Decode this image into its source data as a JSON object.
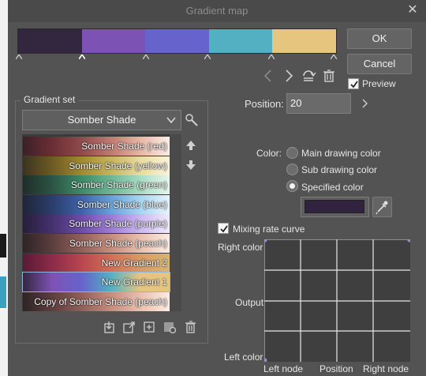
{
  "dialog": {
    "title": "Gradient map",
    "ok_label": "OK",
    "cancel_label": "Cancel",
    "preview_label": "Preview",
    "preview_checked": true
  },
  "gradient_bar": {
    "segments": [
      "#33273f",
      "#7d52b5",
      "#6663cc",
      "#53b0c2",
      "#e6c57f"
    ],
    "node_colors": [
      "#ffffff",
      "#cfcfcf",
      "#cfcfcf",
      "#cfcfcf",
      "#cfcfcf",
      "#cfcfcf"
    ]
  },
  "gradient_set": {
    "group_label": "Gradient set",
    "selected": "Somber Shade",
    "items": [
      {
        "label": "Somber Shade (red)",
        "colors": [
          "#3a2126",
          "#6b2e34",
          "#8f4a4d",
          "#c07a72",
          "#e7b6a4",
          "#fbeee6"
        ]
      },
      {
        "label": "Somber Shade (yellow)",
        "colors": [
          "#3b3320",
          "#6d5a24",
          "#a08a2e",
          "#c7b45c",
          "#e8dca0",
          "#faf4dc"
        ]
      },
      {
        "label": "Somber Shade (green)",
        "colors": [
          "#1e2e2a",
          "#2c5444",
          "#3e8a67",
          "#6cb693",
          "#a7dcc3",
          "#e6f6ee"
        ]
      },
      {
        "label": "Somber Shade (blue)",
        "colors": [
          "#1f2538",
          "#2b3d6c",
          "#3e62a8",
          "#66a0d8",
          "#a6d5f0",
          "#e6f4fb"
        ]
      },
      {
        "label": "Somber Shade (purple)",
        "colors": [
          "#261f3a",
          "#44316e",
          "#6d4caa",
          "#9b7bd6",
          "#cbb6f0",
          "#f1eafb"
        ]
      },
      {
        "label": "Somber Shade (peach)",
        "colors": [
          "#2e2426",
          "#5c3e3e",
          "#91605a",
          "#c58d7e",
          "#e9bfae",
          "#fbece4"
        ]
      },
      {
        "label": "New Gradient 2",
        "colors": [
          "#5a1a36",
          "#8b2c49",
          "#b8464f",
          "#cf7058",
          "#d79a67",
          "#d9b574"
        ]
      },
      {
        "label": "New Gradient 1",
        "colors": [
          "#33273f",
          "#7d52b5",
          "#6663cc",
          "#53b0c2",
          "#e6c57f",
          "#e6c57f"
        ]
      },
      {
        "label": "Copy of Somber Shade (peach)",
        "colors": [
          "#2e2426",
          "#5c3e3e",
          "#91605a",
          "#c58d7e",
          "#e9bfae",
          "#fbece4"
        ]
      }
    ]
  },
  "node_settings": {
    "position_label": "Position:",
    "position_value": "20",
    "color_label": "Color:",
    "options": [
      "Main drawing color",
      "Sub drawing color",
      "Specified color"
    ],
    "selected_option": "Specified color",
    "specified_color": "#31223f"
  },
  "curve": {
    "mixing_label": "Mixing rate curve",
    "mixing_checked": true,
    "right_color_label": "Right color",
    "output_label": "Output",
    "left_color_label": "Left color",
    "left_node_label": "Left node",
    "position_label": "Position",
    "right_node_label": "Right node"
  }
}
